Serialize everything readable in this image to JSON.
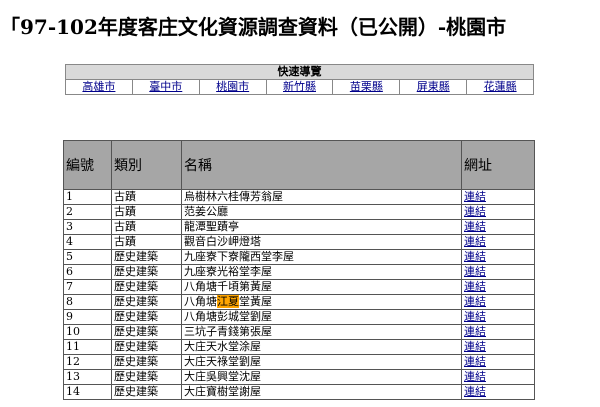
{
  "title": "「97-102年度客庄文化資源調查資料（已公開）-桃園市",
  "nav": {
    "header": "快速導覽",
    "links": [
      "高雄市",
      "臺中市",
      "桃園市",
      "新竹縣",
      "苗栗縣",
      "屏東縣",
      "花蓮縣"
    ]
  },
  "table": {
    "headers": [
      "編號",
      "類別",
      "名稱",
      "網址"
    ],
    "rows": [
      {
        "no": "1",
        "cat": "古蹟",
        "name": "烏樹林六桂傳芳翁屋",
        "url": "連結"
      },
      {
        "no": "2",
        "cat": "古蹟",
        "name": "范姜公廳",
        "url": "連結"
      },
      {
        "no": "3",
        "cat": "古蹟",
        "name": "龍潭聖蹟亭",
        "url": "連結"
      },
      {
        "no": "4",
        "cat": "古蹟",
        "name": "觀音白沙岬燈塔",
        "url": "連結"
      },
      {
        "no": "5",
        "cat": "歷史建築",
        "name": "九座寮下寮隴西堂李屋",
        "url": "連結"
      },
      {
        "no": "6",
        "cat": "歷史建築",
        "name": "九座寮光裕堂李屋",
        "url": "連結"
      },
      {
        "no": "7",
        "cat": "歷史建築",
        "name": "八角塘千頃第黃屋",
        "url": "連結"
      },
      {
        "no": "8",
        "cat": "歷史建築",
        "name_pre": "八角塘",
        "name_hl": "江夏",
        "name_post": "堂黃屋",
        "url": "連結"
      },
      {
        "no": "9",
        "cat": "歷史建築",
        "name": "八角塘彭城堂劉屋",
        "url": "連結"
      },
      {
        "no": "10",
        "cat": "歷史建築",
        "name": "三坑子青錢第張屋",
        "url": "連結"
      },
      {
        "no": "11",
        "cat": "歷史建築",
        "name": "大庄天水堂涂屋",
        "url": "連結"
      },
      {
        "no": "12",
        "cat": "歷史建築",
        "name": "大庄天祿堂劉屋",
        "url": "連結"
      },
      {
        "no": "13",
        "cat": "歷史建築",
        "name": "大庄吳興堂沈屋",
        "url": "連結"
      },
      {
        "no": "14",
        "cat": "歷史建築",
        "name": "大庄寶樹堂謝屋",
        "url": "連結"
      }
    ]
  }
}
